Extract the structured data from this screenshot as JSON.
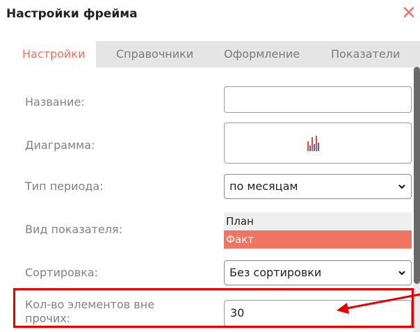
{
  "dialog": {
    "title": "Настройки фрейма",
    "close_symbol": "✕"
  },
  "tabs": [
    {
      "label": "Настройки",
      "active": true
    },
    {
      "label": "Справочники",
      "active": false
    },
    {
      "label": "Оформление",
      "active": false
    },
    {
      "label": "Показатели",
      "active": false
    }
  ],
  "form": {
    "name_label": "Название:",
    "name_value": "",
    "chart_label": "Диаграмма:",
    "chart_icon": "bar-chart-icon",
    "period_label": "Тип периода:",
    "period_value": "по месяцам",
    "indicator_label": "Вид показателя:",
    "indicator_options": [
      {
        "label": "План",
        "selected": false
      },
      {
        "label": "Факт",
        "selected": true
      }
    ],
    "sort_label": "Сортировка:",
    "sort_value": "Без сортировки",
    "count_label_line1": "Кол-во элементов вне",
    "count_label_line2": "прочих:",
    "count_value": "30"
  },
  "colors": {
    "accent": "#ef7462",
    "annotation": "#e80000",
    "chart_red": "#e8463c",
    "chart_blue": "#3d67c9"
  }
}
